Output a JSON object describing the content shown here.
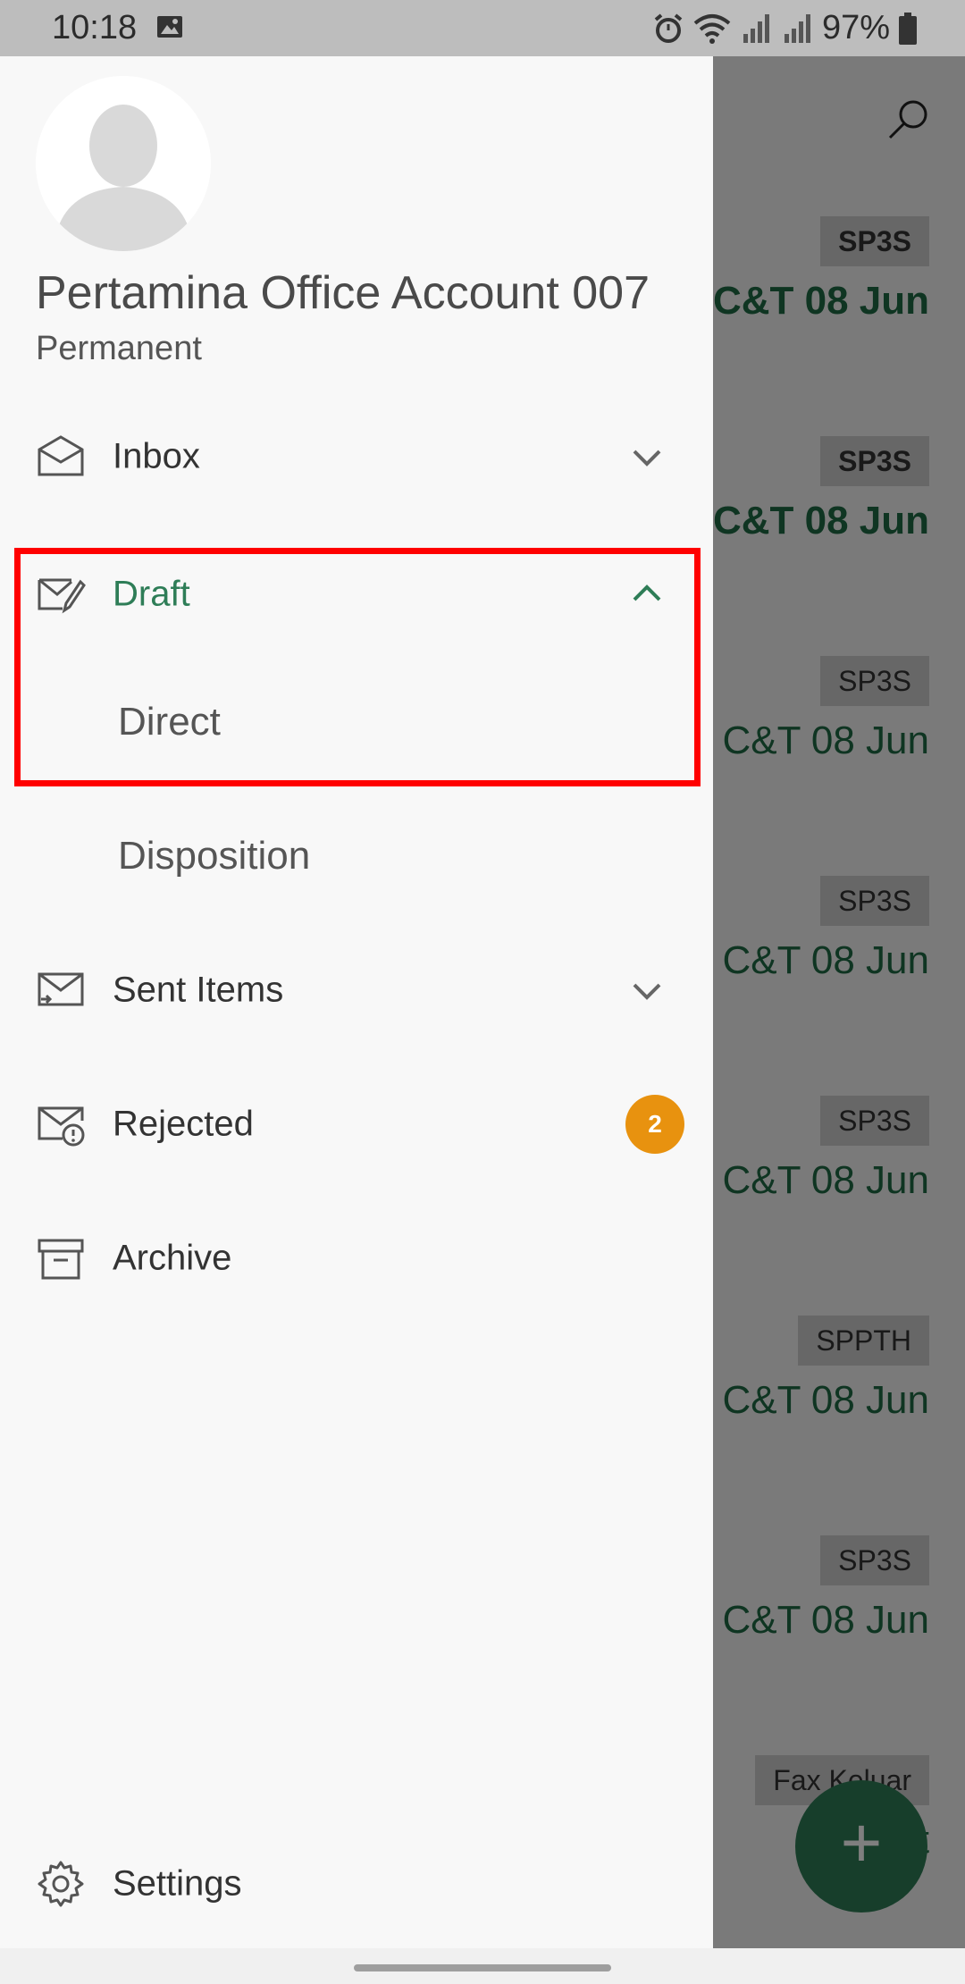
{
  "status_bar": {
    "time": "10:18",
    "battery": "97%"
  },
  "background_list": [
    {
      "tag": "SP3S",
      "date": "C&T 08 Jun",
      "bold": true
    },
    {
      "tag": "SP3S",
      "date": "C&T 08 Jun",
      "bold": true
    },
    {
      "tag": "SP3S",
      "date": "C&T 08 Jun",
      "bold": false
    },
    {
      "tag": "SP3S",
      "date": "C&T 08 Jun",
      "bold": false
    },
    {
      "tag": "SP3S",
      "date": "C&T 08 Jun",
      "bold": false
    },
    {
      "tag": "SPPTH",
      "date": "C&T 08 Jun",
      "bold": false
    },
    {
      "tag": "SP3S",
      "date": "C&T 08 Jun",
      "bold": false
    },
    {
      "tag": "Fax Keluar",
      "date": "nent",
      "bold": false
    }
  ],
  "fab": {
    "label": "+"
  },
  "drawer": {
    "account_name": "Pertamina Office Account 007",
    "account_subtitle": "Permanent",
    "items": {
      "inbox": "Inbox",
      "draft": "Draft",
      "direct": "Direct",
      "disposition": "Disposition",
      "sent_items": "Sent Items",
      "rejected": "Rejected",
      "rejected_count": "2",
      "archive": "Archive",
      "settings": "Settings"
    }
  },
  "colors": {
    "accent_green": "#2e7d57",
    "badge_orange": "#e8920f",
    "highlight_red": "#ff0000"
  }
}
